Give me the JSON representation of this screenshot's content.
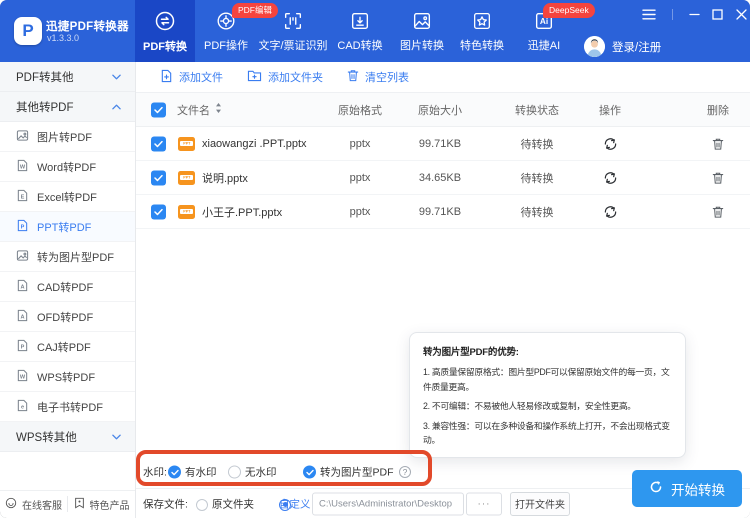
{
  "app": {
    "name": "迅捷PDF转换器",
    "version": "v1.3.3.0",
    "logo_letter": "P"
  },
  "colors": {
    "header": "#2b62d9",
    "header_active": "#1a47c6",
    "accent": "#3a7df0",
    "badge": "#f5443e",
    "annotation": "#e2492a",
    "start_button": "#2e97ef",
    "checkbox": "#2b87f2",
    "file_icon": "#f6941e"
  },
  "nav": {
    "items": [
      {
        "label": "PDF转换",
        "icon": "convert-icon",
        "active": true
      },
      {
        "label": "PDF操作",
        "icon": "gear-icon"
      },
      {
        "label": "文字/票证识别",
        "icon": "ocr-icon",
        "badge": "PDF编辑"
      },
      {
        "label": "CAD转换",
        "icon": "cad-icon"
      },
      {
        "label": "图片转换",
        "icon": "image-icon"
      },
      {
        "label": "特色转换",
        "icon": "star-icon"
      },
      {
        "label": "迅捷AI",
        "icon": "ai-icon",
        "badge": "DeepSeek"
      }
    ],
    "login": "登录/注册"
  },
  "sidebar": {
    "sections": [
      {
        "label": "PDF转其他",
        "state": "collapsed"
      },
      {
        "label": "其他转PDF",
        "state": "expanded"
      },
      {
        "label": "WPS转其他",
        "state": "collapsed"
      }
    ],
    "items": [
      {
        "label": "图片转PDF",
        "icon": "image-file-icon",
        "letter": ""
      },
      {
        "label": "Word转PDF",
        "icon": "word-file-icon",
        "letter": "W"
      },
      {
        "label": "Excel转PDF",
        "icon": "excel-file-icon",
        "letter": "E"
      },
      {
        "label": "PPT转PDF",
        "icon": "ppt-file-icon",
        "letter": "P",
        "selected": true
      },
      {
        "label": "转为图片型PDF",
        "icon": "image-file-icon",
        "letter": ""
      },
      {
        "label": "CAD转PDF",
        "icon": "cad-file-icon",
        "letter": "A"
      },
      {
        "label": "OFD转PDF",
        "icon": "ofd-file-icon",
        "letter": "A"
      },
      {
        "label": "CAJ转PDF",
        "icon": "caj-file-icon",
        "letter": "P"
      },
      {
        "label": "WPS转PDF",
        "icon": "wps-file-icon",
        "letter": "W"
      },
      {
        "label": "电子书转PDF",
        "icon": "ebook-file-icon",
        "letter": "e"
      }
    ],
    "footer": [
      {
        "label": "在线客服",
        "icon": "support-icon"
      },
      {
        "label": "特色产品",
        "icon": "product-icon"
      }
    ]
  },
  "toolbar": {
    "add_file": "添加文件",
    "add_folder": "添加文件夹",
    "clear_list": "清空列表"
  },
  "table": {
    "headers": {
      "name": "文件名",
      "format": "原始格式",
      "size": "原始大小",
      "status": "转换状态",
      "action": "操作",
      "delete": "删除"
    },
    "file_badge": "PPT",
    "rows": [
      {
        "name": "xiaowangzi .PPT.pptx",
        "format": "pptx",
        "size": "99.71KB",
        "status": "待转换"
      },
      {
        "name": "说明.pptx",
        "format": "pptx",
        "size": "34.65KB",
        "status": "待转换"
      },
      {
        "name": "小王子.PPT.pptx",
        "format": "pptx",
        "size": "99.71KB",
        "status": "待转换"
      }
    ]
  },
  "tooltip": {
    "title": "转为图片型PDF的优势:",
    "points": [
      "1. 高质量保留原格式：图片型PDF可以保留原始文件的每一页，文件质量更高。",
      "2. 不可编辑：不易被他人轻易修改或复制，安全性更高。",
      "3. 兼容性强：可以在多种设备和操作系统上打开，不会出现格式变动。"
    ]
  },
  "watermark": {
    "label": "水印:",
    "with_label": "有水印",
    "without_label": "无水印",
    "to_image_label": "转为图片型PDF",
    "with_checked": true,
    "to_image_checked": true
  },
  "save": {
    "label": "保存文件:",
    "original_label": "原文件夹",
    "custom_label": "自定义",
    "path": "C:\\Users\\Administrator\\Desktop",
    "more_label": "···",
    "open_label": "打开文件夹",
    "custom_checked": true
  },
  "start": {
    "label": "开始转换"
  }
}
